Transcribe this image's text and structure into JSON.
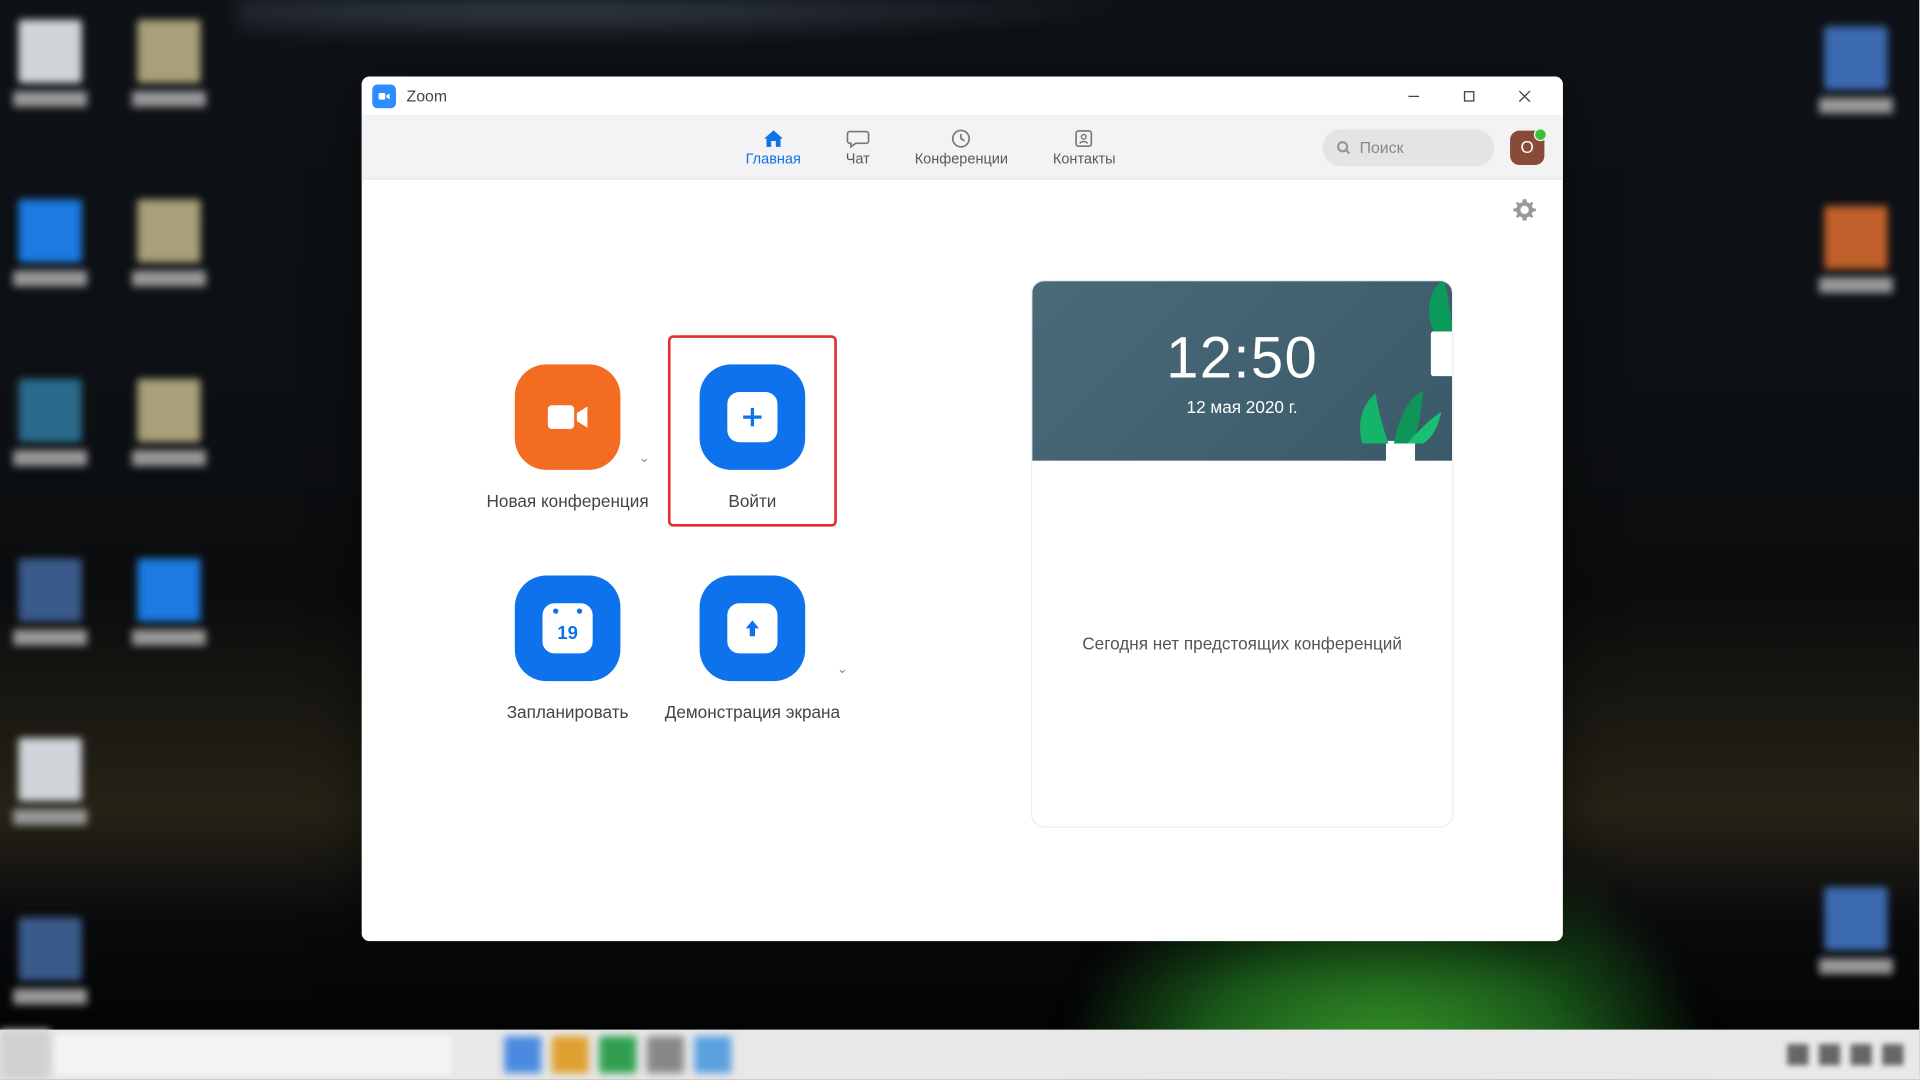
{
  "window": {
    "title": "Zoom"
  },
  "tabs": {
    "home": "Главная",
    "chat": "Чат",
    "meetings": "Конференции",
    "contacts": "Контакты"
  },
  "search": {
    "placeholder": "Поиск"
  },
  "avatar": {
    "initial": "О"
  },
  "actions": {
    "new_meeting": "Новая конференция",
    "join": "Войти",
    "schedule": "Запланировать",
    "schedule_day": "19",
    "share_screen": "Демонстрация экрана"
  },
  "panel": {
    "time": "12:50",
    "date": "12 мая 2020 г.",
    "empty": "Сегодня нет предстоящих конференций"
  },
  "colors": {
    "accent_blue": "#0e72ed",
    "accent_orange": "#f26d21",
    "highlight_red": "#e03030"
  }
}
